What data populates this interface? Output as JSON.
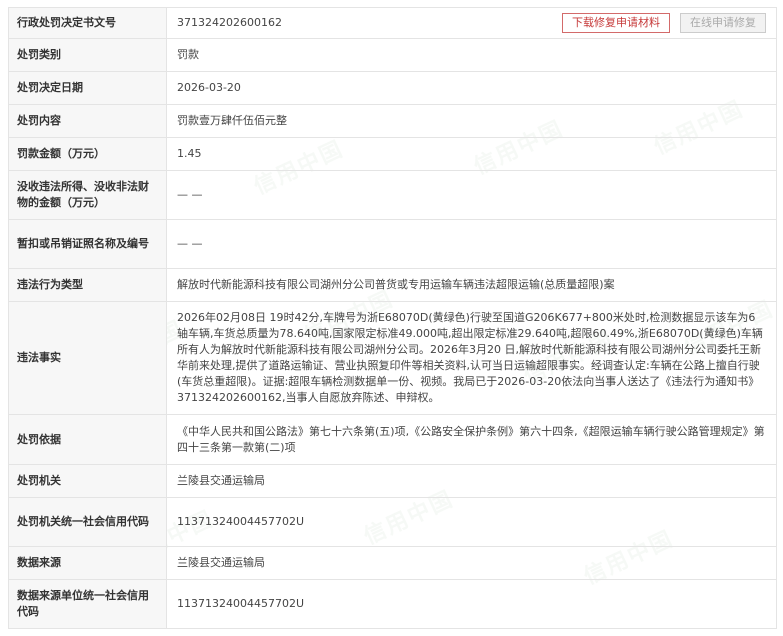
{
  "rows": [
    {
      "label": "行政处罚决定书文号",
      "value": "371324202600162"
    },
    {
      "label": "处罚类别",
      "value": "罚款"
    },
    {
      "label": "处罚决定日期",
      "value": "2026-03-20"
    },
    {
      "label": "处罚内容",
      "value": "罚款壹万肆仟伍佰元整"
    },
    {
      "label": "罚款金额（万元）",
      "value": "1.45"
    },
    {
      "label": "没收违法所得、没收非法财物的金额（万元）",
      "value": "— —"
    },
    {
      "label": "暂扣或吊销证照名称及编号",
      "value": "— —"
    },
    {
      "label": "违法行为类型",
      "value": "解放时代新能源科技有限公司湖州分公司普货或专用运输车辆违法超限运输(总质量超限)案"
    },
    {
      "label": "违法事实",
      "value": "2026年02月08日 19时42分,车牌号为浙E68070D(黄绿色)行驶至国道G206K677+800米处时,检测数据显示该车为6轴车辆,车货总质量为78.640吨,国家限定标准49.000吨,超出限定标准29.640吨,超限60.49%,浙E68070D(黄绿色)车辆所有人为解放时代新能源科技有限公司湖州分公司。2026年3月20 日,解放时代新能源科技有限公司湖州分公司委托王新华前来处理,提供了道路运输证、营业执照复印件等相关资料,认可当日运输超限事实。经调查认定:车辆在公路上擅自行驶(车货总重超限)。证据:超限车辆检测数据单一份、视频。我局已于2026-03-20依法向当事人送达了《违法行为通知书》371324202600162,当事人自愿放弃陈述、申辩权。"
    },
    {
      "label": "处罚依据",
      "value": "《中华人民共和国公路法》第七十六条第(五)项,《公路安全保护条例》第六十四条,《超限运输车辆行驶公路管理规定》第四十三条第一款第(二)项"
    },
    {
      "label": "处罚机关",
      "value": "兰陵县交通运输局"
    },
    {
      "label": "处罚机关统一社会信用代码",
      "value": "11371324004457702U"
    },
    {
      "label": "数据来源",
      "value": "兰陵县交通运输局"
    },
    {
      "label": "数据来源单位统一社会信用代码",
      "value": "11371324004457702U"
    }
  ],
  "actions": {
    "download_label": "下载修复申请材料",
    "online_label": "在线申请修复"
  },
  "watermark": {
    "text": "信用中国"
  }
}
